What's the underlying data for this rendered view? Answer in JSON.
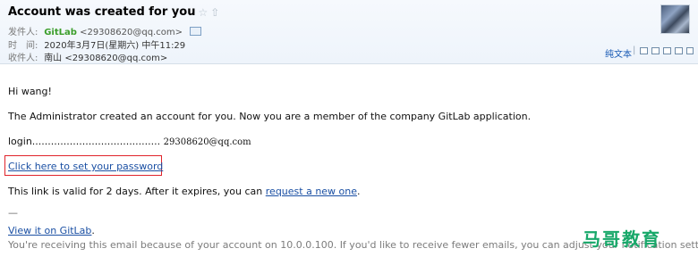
{
  "header": {
    "subject": "Account was created for you",
    "star_icon": "star-outline-icon",
    "arrow_icon": "up-arrow-icon",
    "from_label": "发件人:",
    "from_name": "GitLab",
    "from_address": "<29308620@qq.com>",
    "time_label": "时　间:",
    "time_value": "2020年3月7日(星期六) 中午11:29",
    "to_label": "收件人:",
    "to_value": "南山 <29308620@qq.com>",
    "plain_text_link": "纯文本",
    "separator": "|"
  },
  "body": {
    "greeting": "Hi wang!",
    "intro": "The Administrator created an account for you. Now you are a member of the company GitLab application.",
    "login_label": "login.........................................",
    "login_value": "29308620@qq.com",
    "set_password_link": "Click here to set your password",
    "validity_prefix": "This link is valid for 2 days. After it expires, you can ",
    "request_link": "request a new one",
    "validity_suffix": ".",
    "dash": "—",
    "view_gitlab_link": "View it on GitLab",
    "view_gitlab_suffix": ".",
    "footer": "You're receiving this email because of your account on 10.0.0.100. If you'd like to receive fewer emails, you can adjust your notification settings."
  },
  "watermark": "马哥教育",
  "colors": {
    "sender_green": "#3c9e2b",
    "link_blue": "#1a4fa3",
    "highlight_red": "#e0242b",
    "watermark_green": "#18a86a"
  }
}
